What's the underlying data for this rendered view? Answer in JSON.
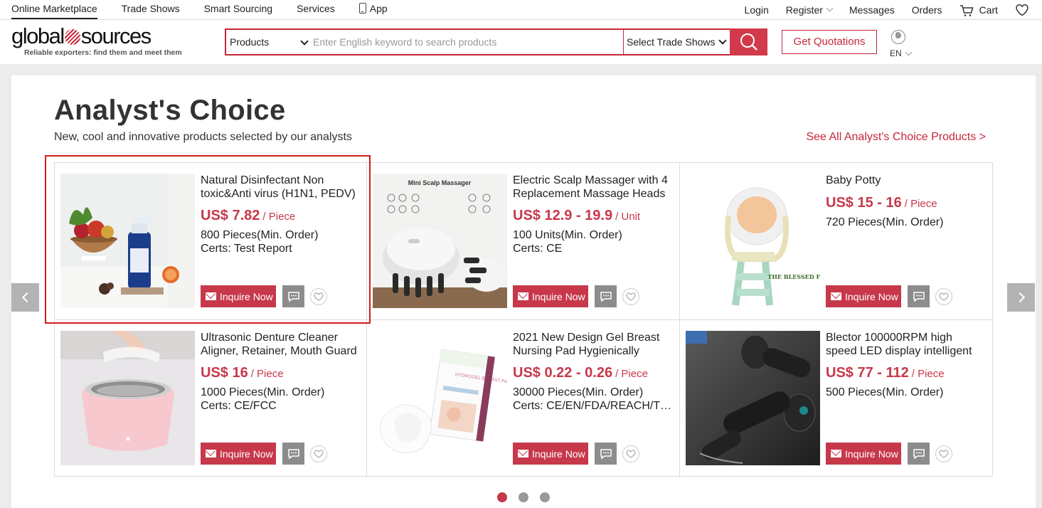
{
  "topnav": {
    "left": [
      "Online Marketplace",
      "Trade Shows",
      "Smart Sourcing",
      "Services",
      "App"
    ],
    "right": {
      "login": "Login",
      "register": "Register",
      "messages": "Messages",
      "orders": "Orders",
      "cart": "Cart"
    }
  },
  "header": {
    "logo_left": "global",
    "logo_right": "sources",
    "tagline": "Reliable exporters: find them and meet them",
    "search": {
      "category": "Products",
      "placeholder": "Enter English keyword to search products",
      "trade_shows": "Select Trade Shows"
    },
    "get_quotations": "Get Quotations",
    "language": "EN"
  },
  "section": {
    "title": "Analyst's Choice",
    "subtitle": "New, cool and innovative products selected by our analysts",
    "see_all": "See All Analyst's Choice Products >"
  },
  "products": [
    {
      "name": "Natural Disinfectant Non toxic&Anti virus (H1N1, PEDV)",
      "price": "US$ 7.82",
      "unit": "/ Piece",
      "moq": "800 Pieces(Min. Order)",
      "certs": "Certs: Test Report",
      "inquire": "Inquire Now"
    },
    {
      "name": "Electric Scalp Massager with 4 Replacement Massage Heads",
      "price": "US$ 12.9 - 19.9",
      "unit": "/ Unit",
      "moq": "100 Units(Min. Order)",
      "certs": "Certs: CE",
      "inquire": "Inquire Now",
      "img_text": "Mini Scalp Massager"
    },
    {
      "name": "Baby Potty",
      "price": "US$ 15 - 16",
      "unit": "/ Piece",
      "moq": "720 Pieces(Min. Order)",
      "certs": "",
      "inquire": "Inquire Now",
      "img_text": "THE BLESSED FOREST"
    },
    {
      "name": "Ultrasonic Denture Cleaner Aligner, Retainer, Mouth Guard",
      "price": "US$ 16",
      "unit": "/ Piece",
      "moq": "1000 Pieces(Min. Order)",
      "certs": "Certs: CE/FCC",
      "inquire": "Inquire Now"
    },
    {
      "name": "2021 New Design Gel Breast Nursing Pad Hygienically",
      "price": "US$ 0.22 - 0.26",
      "unit": "/ Piece",
      "moq": "30000 Pieces(Min. Order)",
      "certs": "Certs: CE/EN/FDA/REACH/TUV",
      "inquire": "Inquire Now",
      "img_text": "HYDROGEL BREAST PADS"
    },
    {
      "name": "Blector 100000RPM high speed LED display intelligent",
      "price": "US$ 77 - 112",
      "unit": "/ Piece",
      "moq": "500 Pieces(Min. Order)",
      "certs": "",
      "inquire": "Inquire Now"
    }
  ],
  "pagination": {
    "pages": 3,
    "active": 1
  },
  "colors": {
    "brand": "#c7273a",
    "price": "#c7384a",
    "highlight": "#d11c1c"
  }
}
